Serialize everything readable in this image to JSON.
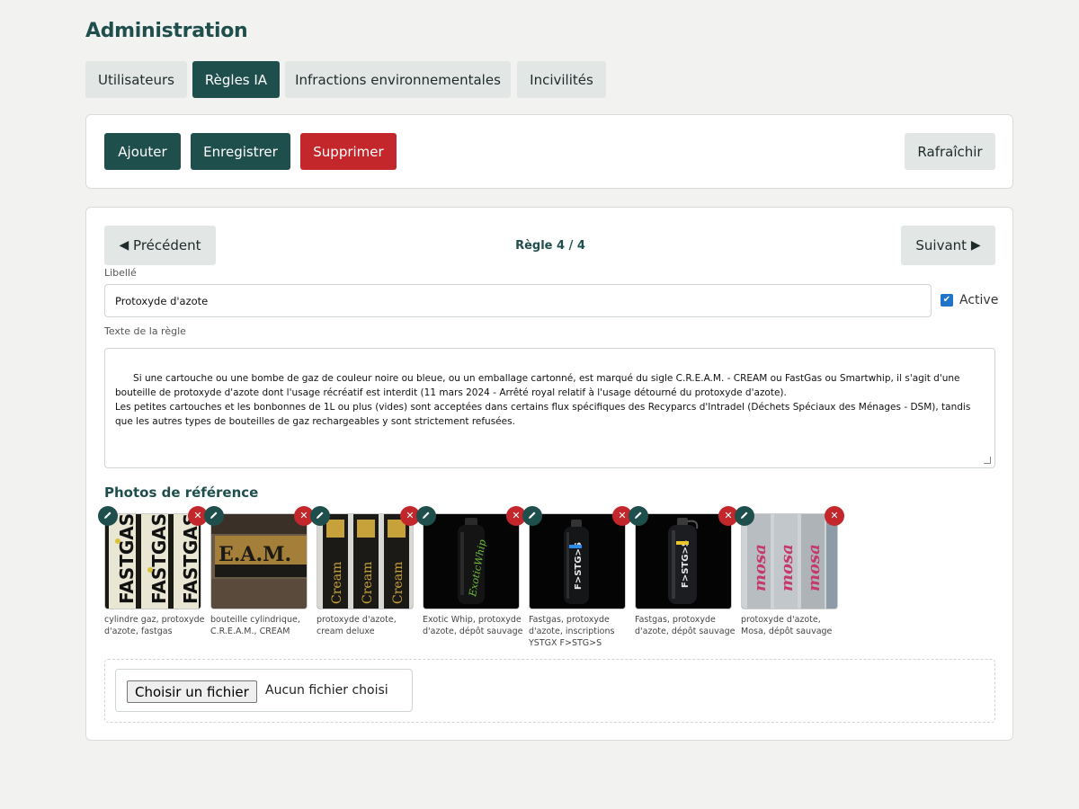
{
  "header": {
    "title": "Administration"
  },
  "tabs": [
    {
      "label": "Utilisateurs",
      "active": false
    },
    {
      "label": "Règles IA",
      "active": true
    },
    {
      "label": "Infractions environnementales",
      "active": false
    },
    {
      "label": "Incivilités",
      "active": false
    }
  ],
  "toolbar": {
    "add_label": "Ajouter",
    "save_label": "Enregistrer",
    "delete_label": "Supprimer",
    "refresh_label": "Rafraîchir"
  },
  "nav": {
    "prev_label": "Précédent",
    "next_label": "Suivant",
    "counter": "Règle 4 / 4"
  },
  "form": {
    "title_label": "Libellé",
    "title_value": "Protoxyde d'azote",
    "active_label": "Active",
    "active_checked": true,
    "text_label": "Texte de la règle",
    "text_value": "Si une cartouche ou une bombe de gaz de couleur noire ou bleue, ou un emballage cartonné, est marqué du sigle C.R.E.A.M. - CREAM ou FastGas ou Smartwhip, il s'agit d'une bouteille de protoxyde d'azote dont l'usage récréatif est interdit (11 mars 2024 - Arrêté royal relatif à l'usage détourné du protoxyde d'azote).\nLes petites cartouches et les bonbonnes de 1L ou plus (vides) sont acceptées dans certains flux spécifiques des Recyparcs d'Intradel (Déchets Spéciaux des Ménages - DSM), tandis que les autres types de bouteilles de gaz rechargeables y sont strictement refusées."
  },
  "photos": {
    "section_title": "Photos de référence",
    "items": [
      {
        "caption": "cylindre gaz, protoxyde d'azote, fastgas",
        "art_text": "FASTGAS"
      },
      {
        "caption": "bouteille cylindrique, C.R.E.A.M., CREAM",
        "art_text": "E.A.M."
      },
      {
        "caption": "protoxyde d'azote, cream deluxe",
        "art_text": "Cream"
      },
      {
        "caption": "Exotic Whip, protoxyde d'azote, dépôt sauvage",
        "art_text": "ExoticWhip"
      },
      {
        "caption": "Fastgas, protoxyde d'azote, inscriptions YSTGX F>STG>S",
        "art_text": "F>STG>S"
      },
      {
        "caption": "Fastgas, protoxyde d'azote, dépôt sauvage",
        "art_text": "F>STG>S"
      },
      {
        "caption": "protoxyde d'azote, Mosa, dépôt sauvage",
        "art_text": "mosa"
      }
    ]
  },
  "upload": {
    "button_label": "Choisir un fichier",
    "status": "Aucun fichier choisi"
  },
  "colors": {
    "primary": "#1f4f4d",
    "danger": "#c3272b",
    "secondary": "#e2e7e6",
    "background": "#f2f2f0"
  }
}
